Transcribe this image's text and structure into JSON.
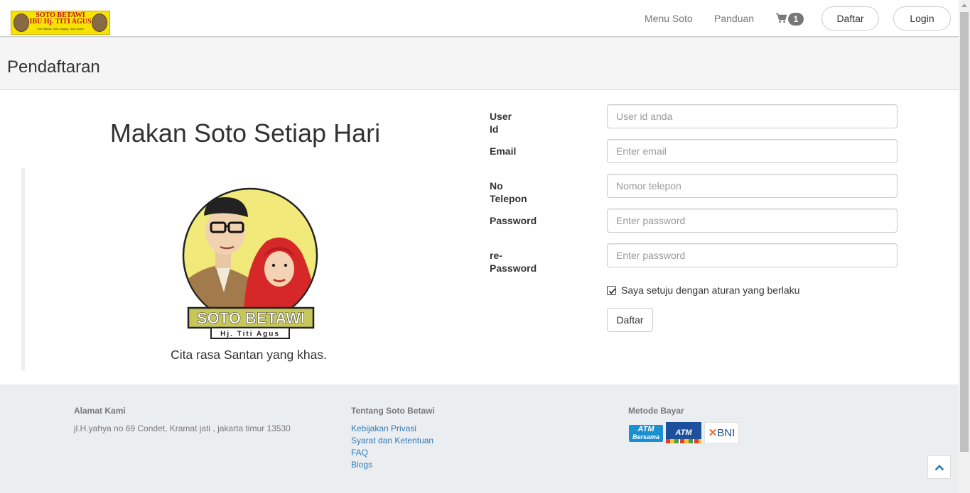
{
  "brand": {
    "line1": "SOTO BETAWI",
    "line2": "IBU Hj. TITI AGUS",
    "line3": "Soto Babat, Soto Daging, Soto Ayam"
  },
  "nav": {
    "menu_label": "Menu Soto",
    "guide_label": "Panduan",
    "cart_icon": "shopping-cart-icon",
    "cart_count": "1",
    "register_label": "Daftar",
    "login_label": "Login"
  },
  "page": {
    "title": "Pendaftaran"
  },
  "hero": {
    "title": "Makan Soto Setiap Hari",
    "logo_name": "SOTO BETAWI",
    "logo_sub": "Hj. Titi Agus",
    "tagline": "Cita rasa Santan yang khas."
  },
  "form": {
    "fields": [
      {
        "label": "User Id",
        "placeholder": "User id anda"
      },
      {
        "label": "Email",
        "placeholder": "Enter email"
      },
      {
        "label": "No Telepon",
        "placeholder": "Nomor telepon"
      },
      {
        "label": "Password",
        "placeholder": "Enter password"
      },
      {
        "label": "re-Password",
        "placeholder": "Enter password"
      }
    ],
    "agree_label": "Saya setuju dengan aturan yang berlaku",
    "agree_checked": true,
    "submit_label": "Daftar"
  },
  "footer": {
    "address_heading": "Alamat Kami",
    "address": "jl.H.yahya no 69 Condet, Kramat jati , jakarta timur 13530",
    "about_heading": "Tentang Soto Betawi",
    "links": [
      "Kebijakan Privasi",
      "Syarat dan Ketentuan",
      "FAQ",
      "Blogs"
    ],
    "payment_heading": "Metode Bayar",
    "payment": {
      "atm_bersama_top": "ATM",
      "atm_bersama_bottom": "Bersama",
      "atm": "ATM",
      "bni": "BNI"
    }
  },
  "colors": {
    "link": "#337ab7",
    "footer_bg": "#ebeef1",
    "header_bg": "#f5f5f5",
    "brand_yellow": "#f6e300",
    "brand_red": "#c8102e"
  }
}
